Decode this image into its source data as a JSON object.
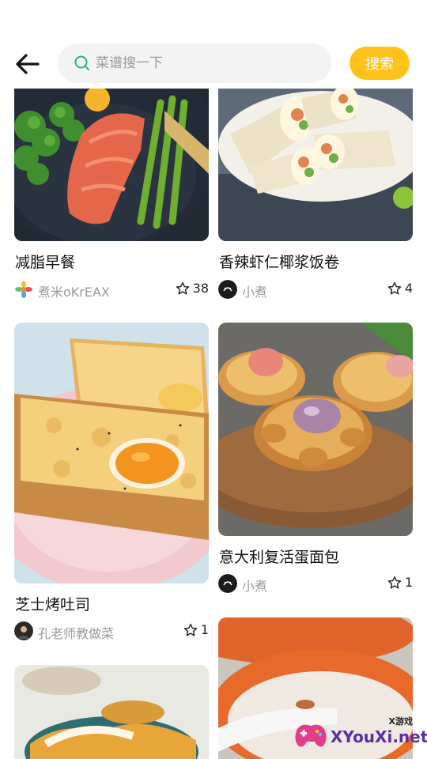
{
  "header": {
    "search_placeholder": "菜谱搜一下",
    "search_button": "搜索"
  },
  "cards": [
    {
      "title": "减脂早餐",
      "author": "煮米oKrEAX",
      "favorites": "38"
    },
    {
      "title": "香辣虾仁椰浆饭卷",
      "author": "小煮",
      "favorites": "4"
    },
    {
      "title": "芝士烤吐司",
      "author": "孔老师教做菜",
      "favorites": "1"
    },
    {
      "title": "意大利复活蛋面包",
      "author": "小煮",
      "favorites": "1"
    },
    {
      "title": "",
      "author": "",
      "favorites": ""
    },
    {
      "title": "",
      "author": "",
      "favorites": ""
    }
  ],
  "watermark": {
    "top": "X游戏",
    "main": "XYouXi.net"
  },
  "colors": {
    "accent": "#ffc21a",
    "search_bg": "#f3f3f3",
    "muted_text": "#9b9b9b"
  },
  "icons": {
    "back": "back-arrow-icon",
    "search": "search-icon",
    "favorite": "star-outline-icon"
  }
}
